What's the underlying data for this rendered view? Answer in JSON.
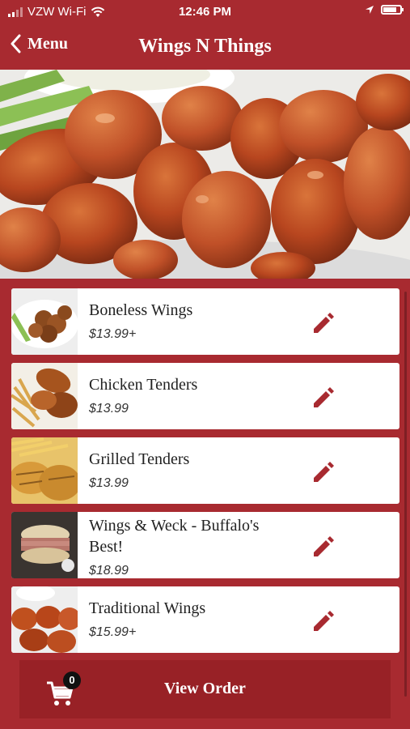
{
  "status_bar": {
    "carrier": "VZW Wi-Fi",
    "time": "12:46 PM",
    "battery_level": 0.8
  },
  "nav": {
    "back_label": "Menu",
    "title": "Wings N Things"
  },
  "items": [
    {
      "name": "Boneless Wings",
      "price": "$13.99+"
    },
    {
      "name": "Chicken Tenders",
      "price": "$13.99"
    },
    {
      "name": "Grilled Tenders",
      "price": "$13.99"
    },
    {
      "name": "Wings & Weck - Buffalo's Best!",
      "price": "$18.99"
    },
    {
      "name": "Traditional Wings",
      "price": "$15.99+"
    }
  ],
  "footer": {
    "cart_count": "0",
    "view_order_label": "View Order"
  },
  "colors": {
    "brand_red": "#a82a30",
    "footer_red": "#982126",
    "icon_red": "#a82a30"
  }
}
